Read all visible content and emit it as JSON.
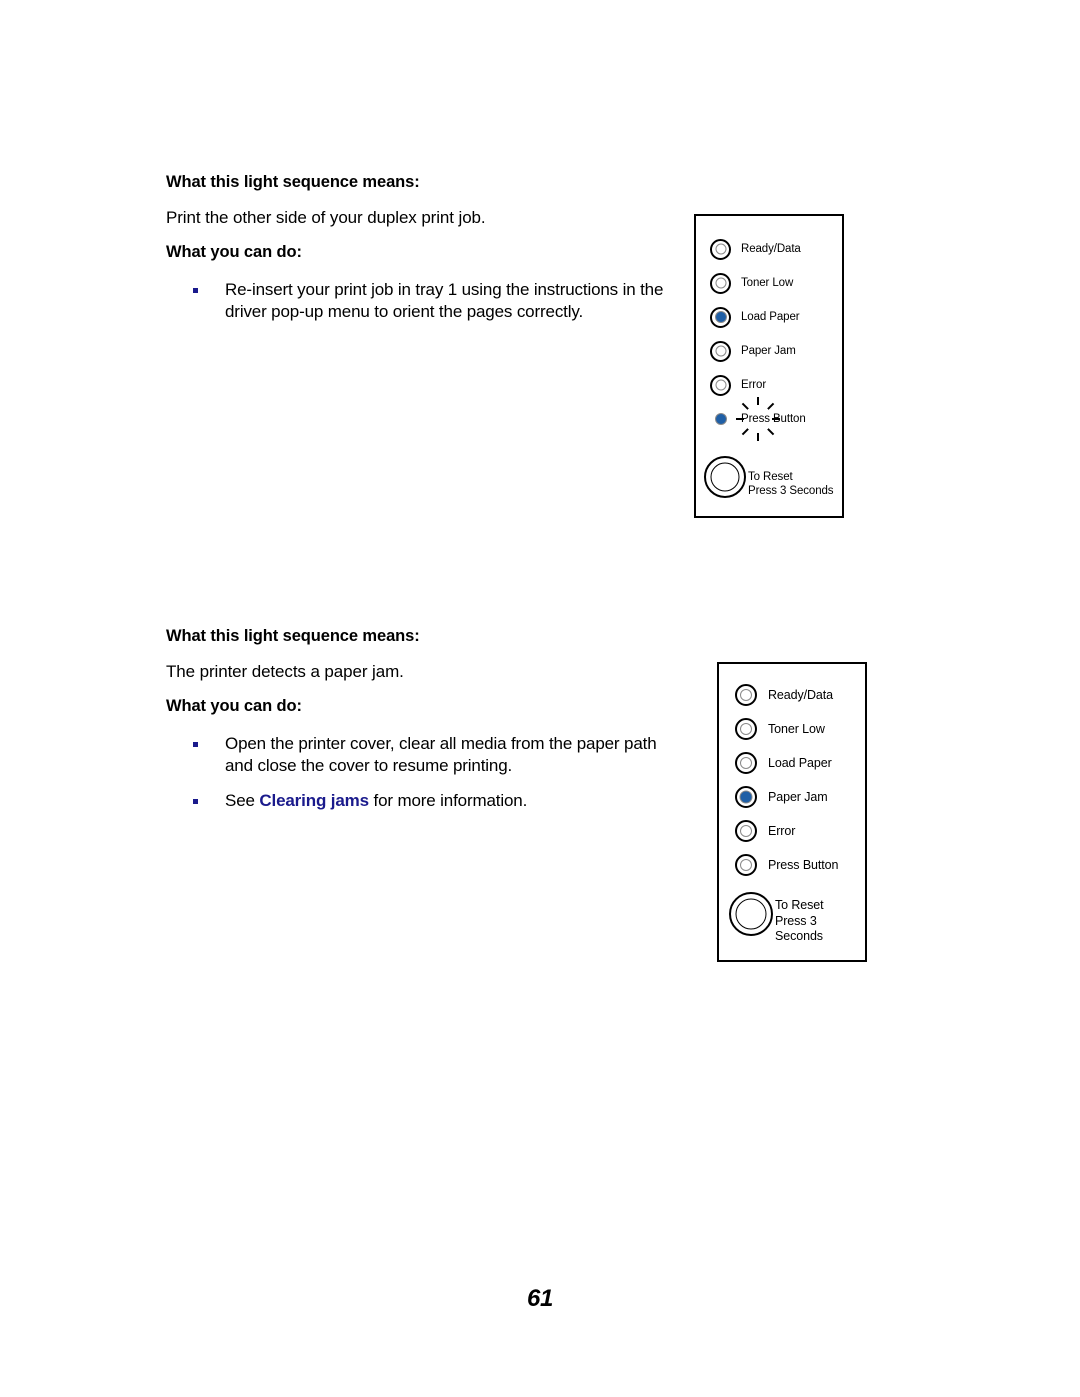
{
  "document": {
    "page_number": "61",
    "link_color": "#1a1a8c",
    "led_on_color": "#1f5fa6"
  },
  "sections": [
    {
      "means_heading": "What this light sequence means:",
      "means_text": "Print the other side of your duplex print job.",
      "can_do_heading": "What you can do:",
      "bullets": [
        {
          "text_before": "Re-insert your print job in tray 1 using the instructions in the driver pop-up menu to orient the pages correctly.",
          "link": "",
          "text_after": ""
        }
      ]
    },
    {
      "means_heading": "What this light sequence means:",
      "means_text": "The printer detects a paper jam.",
      "can_do_heading": "What you can do:",
      "bullets": [
        {
          "text_before": "Open the printer cover, clear all media from the paper path and close the cover to resume printing.",
          "link": "",
          "text_after": ""
        },
        {
          "text_before": "See ",
          "link": "Clearing jams",
          "text_after": " for more information."
        }
      ]
    }
  ],
  "panels": [
    {
      "name": "duplex-print-job-light-sequence",
      "leds": [
        {
          "label": "Ready/Data",
          "state": "off"
        },
        {
          "label": "Toner Low",
          "state": "off"
        },
        {
          "label": "Load Paper",
          "state": "on"
        },
        {
          "label": "Paper Jam",
          "state": "off"
        },
        {
          "label": "Error",
          "state": "off"
        },
        {
          "label": "Press Button",
          "state": "blinking"
        }
      ],
      "reset": {
        "line1": "To Reset",
        "line2": "Press 3 Seconds"
      }
    },
    {
      "name": "paper-jam-light-sequence",
      "leds": [
        {
          "label": "Ready/Data",
          "state": "off"
        },
        {
          "label": "Toner Low",
          "state": "off"
        },
        {
          "label": "Load Paper",
          "state": "off"
        },
        {
          "label": "Paper Jam",
          "state": "on"
        },
        {
          "label": "Error",
          "state": "off"
        },
        {
          "label": "Press Button",
          "state": "off"
        }
      ],
      "reset": {
        "line1": "To Reset",
        "line2": "Press 3 Seconds"
      }
    }
  ]
}
